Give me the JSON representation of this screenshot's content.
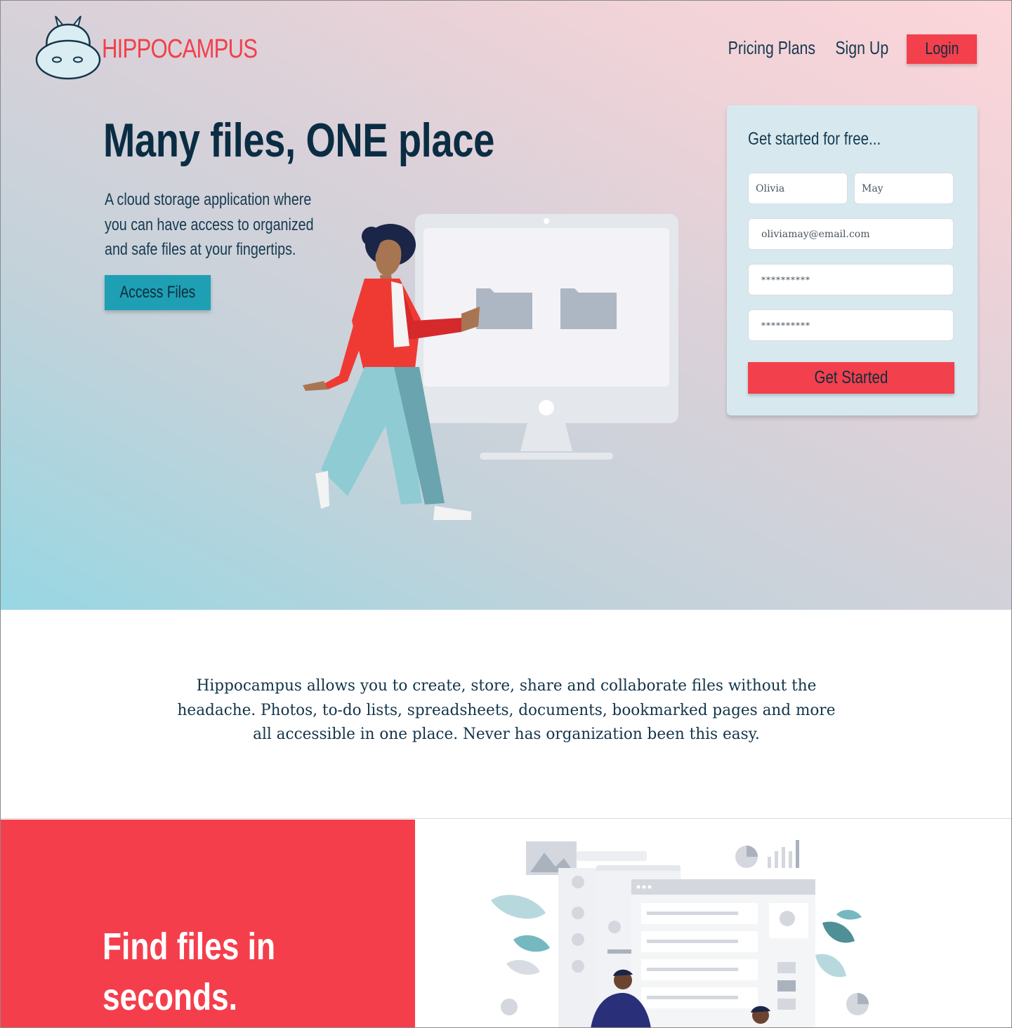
{
  "brand": {
    "name": "HIPPOCAMPUS",
    "accent": "#f2404c",
    "teal": "#1e9fb3"
  },
  "nav": {
    "pricing": "Pricing Plans",
    "signup": "Sign Up",
    "login": "Login"
  },
  "hero": {
    "headline": "Many files, ONE place",
    "subtext": "A cloud storage application where you can have access to organized and safe files at your fingertips.",
    "cta": "Access Files"
  },
  "signup": {
    "title": "Get started for free...",
    "first_name": "Olivia",
    "last_name": "May",
    "email": "oliviamay@email.com",
    "password": "**********",
    "confirm_password": "**********",
    "submit": "Get Started"
  },
  "about": {
    "text": "Hippocampus allows you to create, store, share and collaborate files without the headache. Photos, to-do lists, spreadsheets, documents, bookmarked pages and more all accessible in one place. Never has organization been this easy."
  },
  "feature": {
    "title": "Find files in seconds."
  }
}
